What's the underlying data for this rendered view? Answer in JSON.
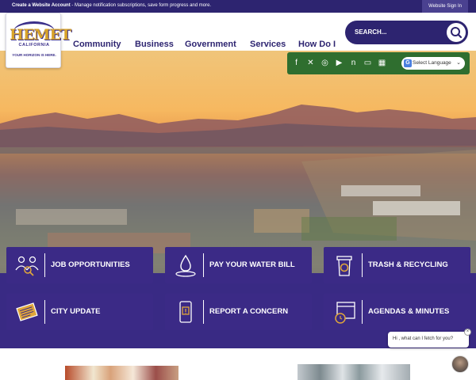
{
  "topbar": {
    "account_link": "Create a Website Account",
    "account_text": " - Manage notification subscriptions, save form progress and more.",
    "signin": "Website Sign In"
  },
  "logo": {
    "word": "HEMET",
    "sub": "CALIFORNIA",
    "tagline": "YOUR HORIZON IS HERE."
  },
  "nav": [
    "Community",
    "Business",
    "Government",
    "Services",
    "How Do I"
  ],
  "search": {
    "placeholder": "SEARCH..."
  },
  "social": {
    "icons": [
      "facebook-icon",
      "x-twitter-icon",
      "instagram-icon",
      "youtube-icon",
      "nextdoor-icon",
      "tv-icon",
      "calendar-icon"
    ],
    "language_label": "Select Language"
  },
  "tiles": [
    {
      "label": "JOB OPPORTUNITIES",
      "icon": "people-search-icon"
    },
    {
      "label": "PAY YOUR WATER BILL",
      "icon": "water-drop-icon"
    },
    {
      "label": "TRASH & RECYCLING",
      "icon": "recycle-bin-icon"
    },
    {
      "label": "CITY UPDATE",
      "icon": "newspaper-icon"
    },
    {
      "label": "REPORT A CONCERN",
      "icon": "phone-alert-icon"
    },
    {
      "label": "AGENDAS & MINUTES",
      "icon": "calendar-clock-icon"
    }
  ],
  "chat": {
    "greeting": "Hi , what can I fetch for you?"
  },
  "colors": {
    "brand_purple": "#2d2470",
    "tile_purple": "#3b2a86",
    "social_green": "#2f6e2f",
    "gold": "#d8a32a"
  }
}
